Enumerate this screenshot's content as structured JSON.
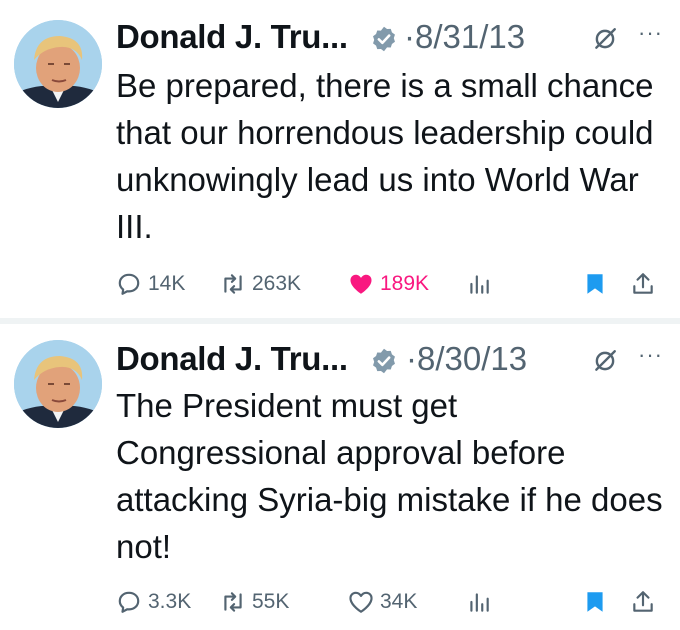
{
  "tweets": [
    {
      "author": "Donald J. Tru...",
      "date": "·8/31/13",
      "text": "Be prepared, there is a small chance that our horrendous leadership could unknowingly lead us into World War III.",
      "stats": {
        "replies": "14K",
        "retweets": "263K",
        "likes": "189K"
      },
      "liked": true,
      "bookmarked": true
    },
    {
      "author": "Donald J. Tru...",
      "date": "·8/30/13",
      "text": "The President must get Congressional approval before attacking Syria-big mistake if he does not!",
      "stats": {
        "replies": "3.3K",
        "retweets": "55K",
        "likes": "34K"
      },
      "liked": false,
      "bookmarked": true
    }
  ],
  "icons": {
    "verified": "verified-badge-icon",
    "grok": "grok-icon",
    "more": "more-icon",
    "reply": "reply-icon",
    "retweet": "retweet-icon",
    "like": "heart-icon",
    "views": "views-icon",
    "bookmark": "bookmark-icon",
    "share": "share-icon"
  },
  "colors": {
    "text": "#0f1419",
    "secondary": "#536471",
    "accent": "#1d9bf0",
    "like": "#f91880",
    "verified": "#829aab",
    "divider": "#eff3f4"
  }
}
